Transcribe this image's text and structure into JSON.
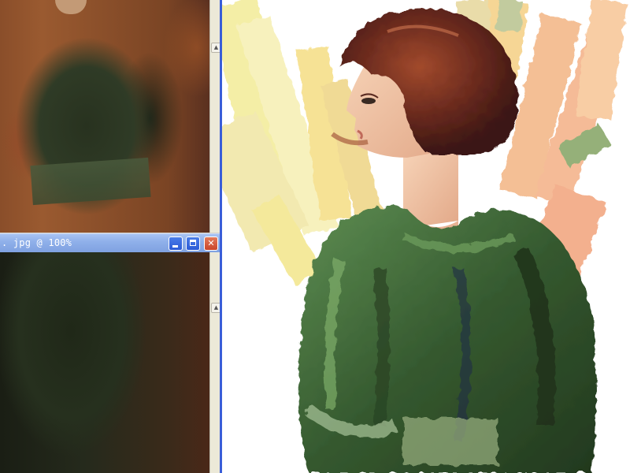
{
  "reference_window": {
    "title": ". jpg @ 100%",
    "buttons": {
      "minimize": "minimize",
      "maximize": "maximize",
      "close": "close"
    }
  },
  "colors": {
    "titlebar": "#8fb0ea",
    "divider": "#3a5ed8",
    "close_button": "#c9452a",
    "dress_green": "#3f6a3a",
    "hair": "#6a2a1e",
    "skin": "#f2c4a6"
  }
}
